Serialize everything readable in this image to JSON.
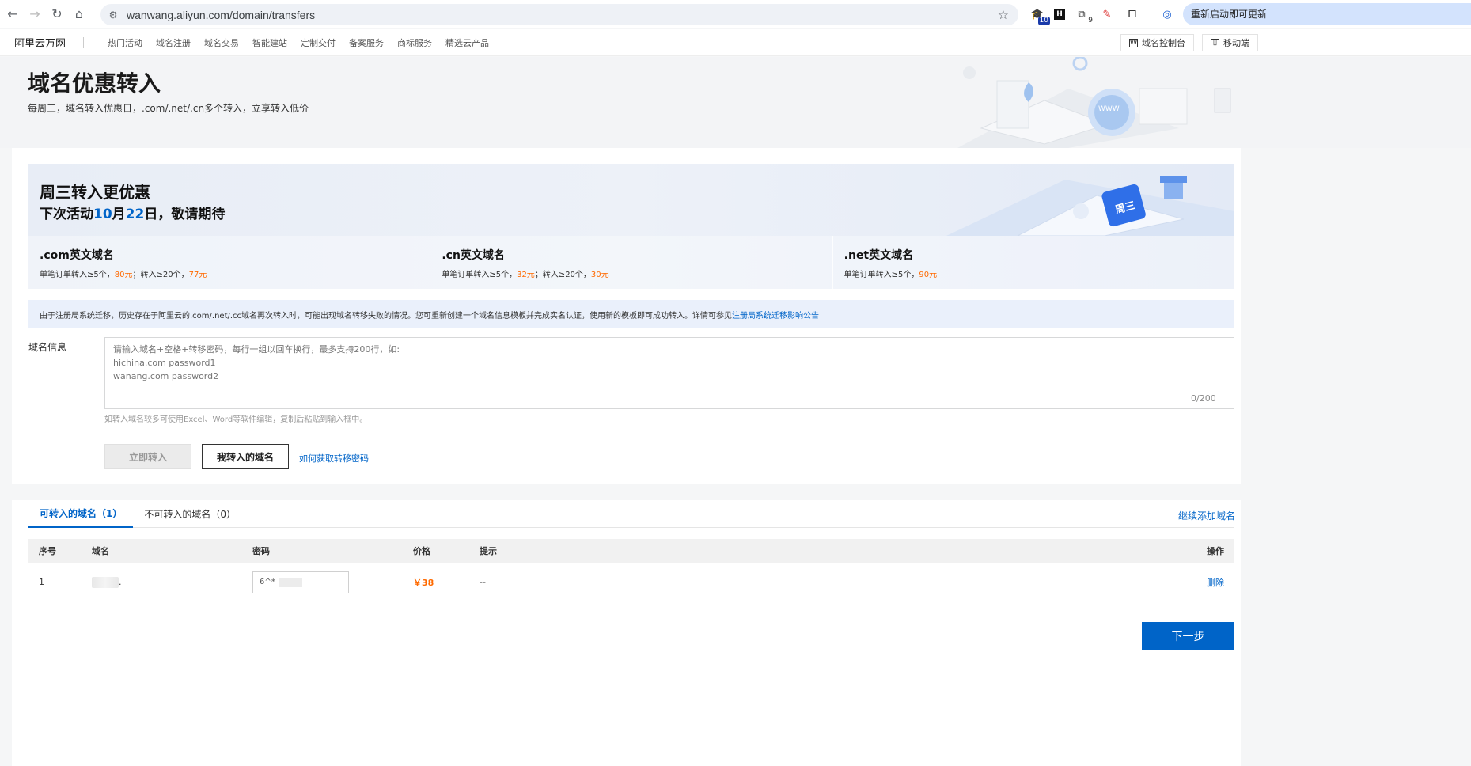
{
  "browser": {
    "url": "wanwang.aliyun.com/domain/transfers",
    "ext_badge_1": "10",
    "ext_badge_2": "9",
    "restart_label": "重新启动即可更新"
  },
  "header": {
    "logo": "阿里云万网",
    "nav": [
      "热门活动",
      "域名注册",
      "域名交易",
      "智能建站",
      "定制交付",
      "备案服务",
      "商标服务",
      "精选云产品"
    ],
    "console_btn": "域名控制台",
    "mobile_btn": "移动端"
  },
  "hero": {
    "title": "域名优惠转入",
    "subtitle": "每周三，域名转入优惠日，.com/.net/.cn多个转入，立享转入低价"
  },
  "promo": {
    "title": "周三转入更优惠",
    "date_prefix": "下次活动",
    "month": "10",
    "month_unit": "月",
    "day": "22",
    "date_suffix": "日，敬请期待",
    "cells": [
      {
        "title": ".com英文域名",
        "desc_a": "单笔订单转入≥5个，",
        "price_a": "80元",
        "desc_b": "；转入≥20个，",
        "price_b": "77元"
      },
      {
        "title": ".cn英文域名",
        "desc_a": "单笔订单转入≥5个，",
        "price_a": "32元",
        "desc_b": "；转入≥20个，",
        "price_b": "30元"
      },
      {
        "title": ".net英文域名",
        "desc_a": "单笔订单转入≥5个，",
        "price_a": "90元",
        "desc_b": "",
        "price_b": ""
      }
    ]
  },
  "notice": {
    "text": "由于注册局系统迁移，历史存在于阿里云的.com/.net/.cc域名再次转入时，可能出现域名转移失败的情况。您可重新创建一个域名信息模板并完成实名认证，使用新的模板即可成功转入。详情可参见",
    "link": "注册局系统迁移影响公告"
  },
  "form": {
    "label": "域名信息",
    "placeholder": "请输入域名+空格+转移密码，每行一组以回车换行，最多支持200行，如:\nhichina.com password1\nwanang.com password2",
    "counter": "0/200",
    "helper": "如转入域名较多可使用Excel、Word等软件编辑，复制后粘贴到输入框中。",
    "transfer_btn": "立即转入",
    "mine_btn": "我转入的域名",
    "howto_link": "如何获取转移密码"
  },
  "tabs": {
    "active": "可转入的域名（1）",
    "inactive": "不可转入的域名（0）",
    "add_more": "继续添加域名"
  },
  "table": {
    "headers": [
      "序号",
      "域名",
      "密码",
      "价格",
      "提示",
      "操作"
    ],
    "rows": [
      {
        "index": "1",
        "domain_suffix": ".",
        "password": "6^*",
        "price": "￥38",
        "hint": "--",
        "action": "删除"
      }
    ]
  },
  "next_btn": "下一步"
}
